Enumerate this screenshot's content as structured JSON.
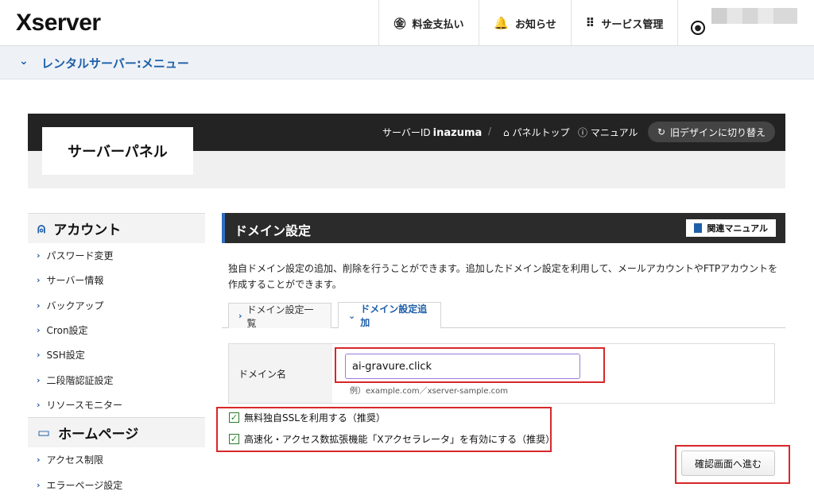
{
  "header": {
    "logo": "Xserver",
    "nav": {
      "payment": "料金支払い",
      "notice": "お知らせ",
      "service": "サービス管理"
    }
  },
  "subheader": {
    "title": "レンタルサーバー:メニュー"
  },
  "panel": {
    "title": "サーバーパネル",
    "server_id_label": "サーバーID",
    "server_id": "inazuma",
    "separator": "/",
    "panel_top": "パネルトップ",
    "manual": "マニュアル",
    "old_design": "旧デザインに切り替え"
  },
  "sidebar": {
    "sections": [
      {
        "title": "アカウント",
        "items": [
          "パスワード変更",
          "サーバー情報",
          "バックアップ",
          "Cron設定",
          "SSH設定",
          "二段階認証設定",
          "リソースモニター"
        ]
      },
      {
        "title": "ホームページ",
        "items": [
          "アクセス制限",
          "エラーページ設定"
        ]
      }
    ]
  },
  "main": {
    "title": "ドメイン設定",
    "manual_button": "関連マニュアル",
    "description": "独自ドメイン設定の追加、削除を行うことができます。追加したドメイン設定を利用して、メールアカウントやFTPアカウントを作成することができます。",
    "tabs": [
      {
        "label": "ドメイン設定一覧",
        "active": false
      },
      {
        "label": "ドメイン設定追加",
        "active": true
      }
    ],
    "form": {
      "domain_label": "ドメイン名",
      "domain_value": "ai-gravure.click",
      "domain_example": "例）example.com／xserver-sample.com",
      "checkboxes": [
        {
          "label": "無料独自SSLを利用する（推奨）",
          "checked": true
        },
        {
          "label": "高速化・アクセス数拡張機能「Xアクセラレータ」を有効にする（推奨）",
          "checked": true
        }
      ],
      "confirm_button": "確認画面へ進む"
    }
  },
  "colors": {
    "accent": "#1f5fa8",
    "dark": "#232323",
    "highlight": "#d8272a"
  }
}
